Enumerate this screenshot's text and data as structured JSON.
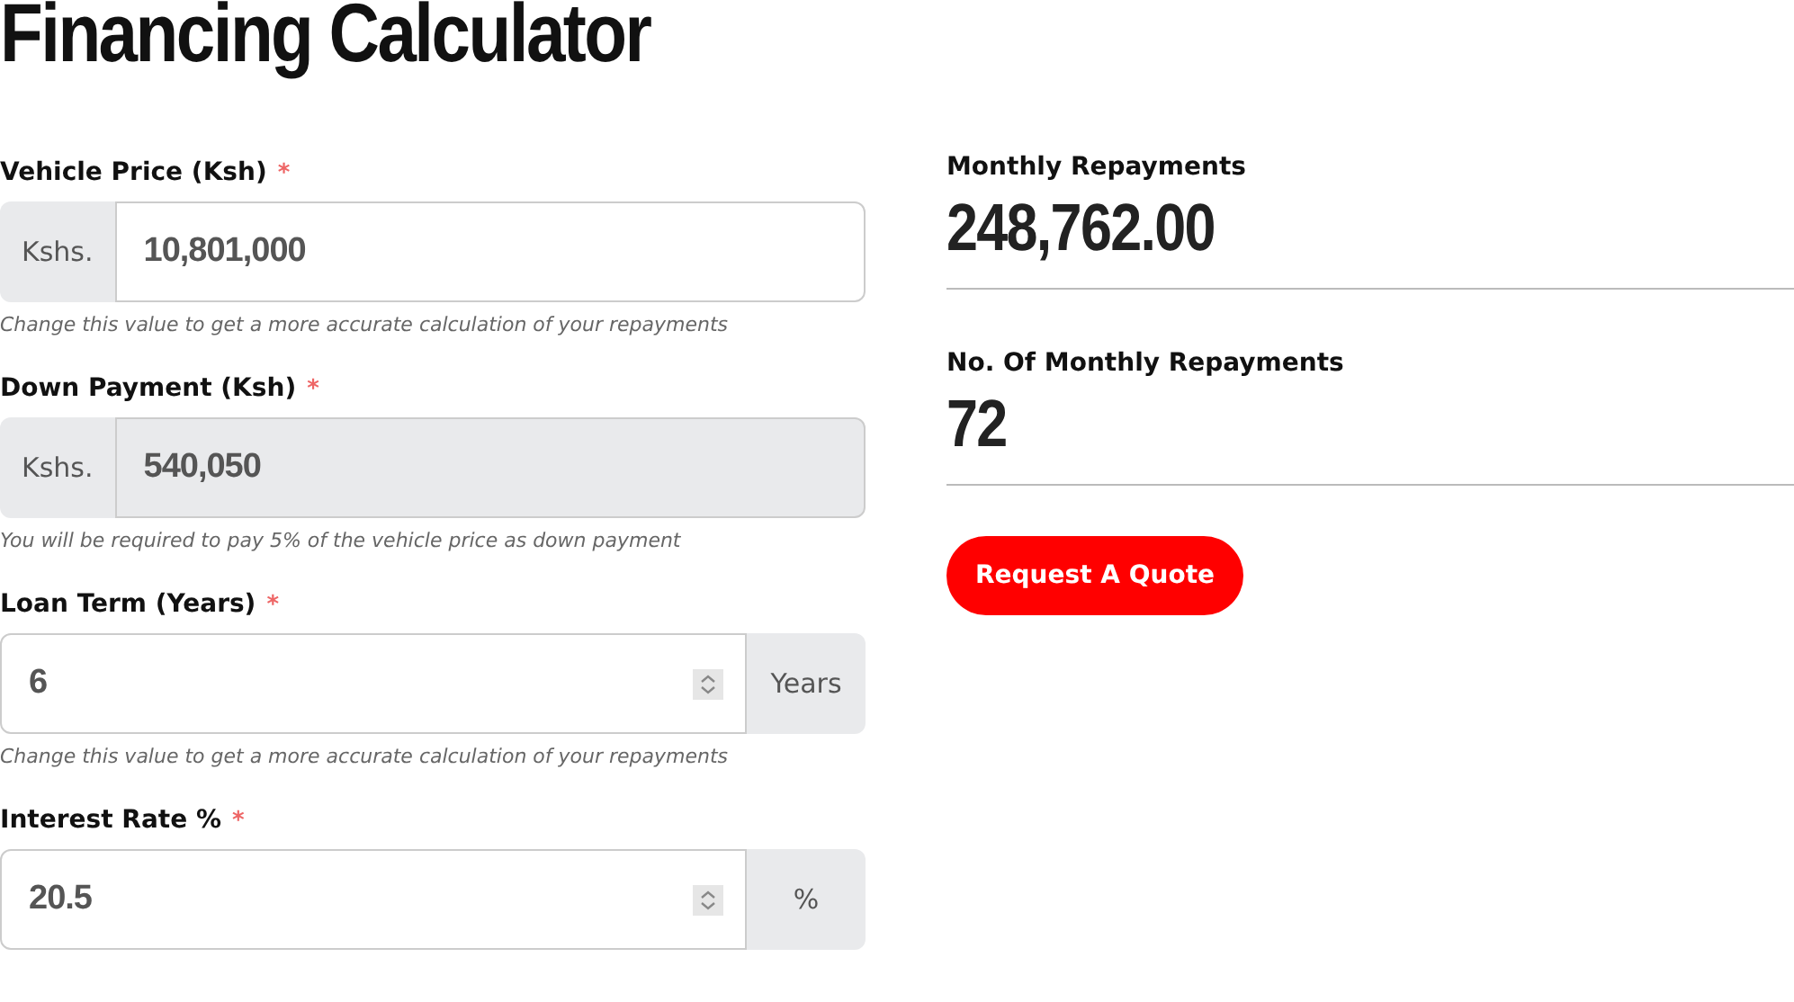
{
  "title": "Financing Calculator",
  "fields": [
    {
      "label": "Vehicle Price (Ksh)",
      "required_mark": "*",
      "kind": "text",
      "prefix": "Kshs.",
      "value": "10,801,000",
      "disabled": false,
      "hint": "Change this value to get a more accurate calculation of your repayments"
    },
    {
      "label": "Down Payment (Ksh)",
      "required_mark": "*",
      "kind": "text",
      "prefix": "Kshs.",
      "value": "540,050",
      "disabled": true,
      "hint": "You will be required to pay 5% of the vehicle price as down payment"
    },
    {
      "label": "Loan Term (Years)",
      "required_mark": "*",
      "kind": "number",
      "suffix": "Years",
      "value": "6",
      "disabled": false,
      "hint": "Change this value to get a more accurate calculation of your repayments"
    },
    {
      "label": "Interest Rate %",
      "required_mark": "*",
      "kind": "number",
      "suffix": "%",
      "value": "20.5",
      "disabled": false
    }
  ],
  "results": [
    {
      "label": "Monthly Repayments",
      "value": "248,762.00"
    },
    {
      "label": "No. Of Monthly Repayments",
      "value": "72"
    }
  ],
  "button": "Request A Quote"
}
